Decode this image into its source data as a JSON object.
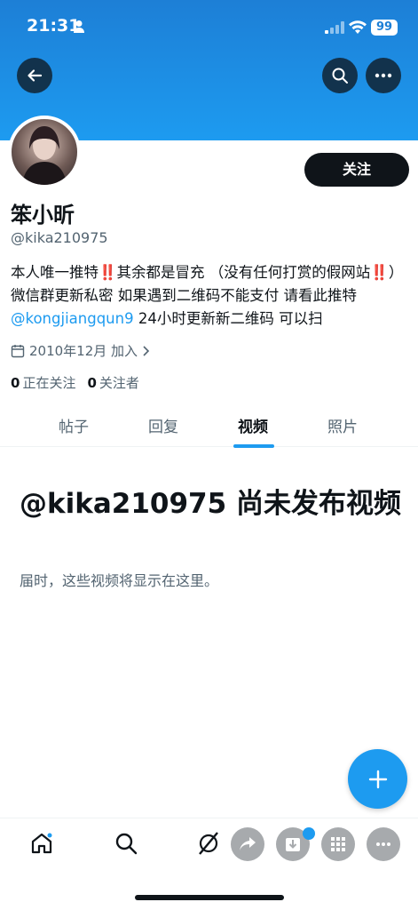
{
  "status_bar": {
    "time": "21:31",
    "battery": "99"
  },
  "profile": {
    "name": "笨小昕",
    "handle": "@kika210975",
    "follow_label": "关注",
    "bio": {
      "part1": "本人唯一推特",
      "bang": "‼️",
      "part2": "其余都是冒充 （没有任何打赏的假网站",
      "part3": "）微信群更新私密 如果遇到二维码不能支付 请看此推特",
      "link": "@kongjiangqun9",
      "part4": " 24小时更新新二维码 可以扫"
    },
    "joined": "2010年12月 加入",
    "following_count": "0",
    "following_label": "正在关注",
    "followers_count": "0",
    "followers_label": "关注者"
  },
  "tabs": [
    {
      "label": "帖子"
    },
    {
      "label": "回复"
    },
    {
      "label": "视频"
    },
    {
      "label": "照片"
    }
  ],
  "active_tab": "视频",
  "empty_state": {
    "title": "@kika210975 尚未发布视频",
    "subtitle": "届时，这些视频将显示在这里。"
  },
  "colors": {
    "accent": "#1d9bf0",
    "text": "#0f1419",
    "muted": "#536471"
  },
  "icons": [
    "back-arrow-icon",
    "search-icon",
    "more-icon",
    "calendar-icon",
    "chevron-right-icon",
    "plus-icon",
    "home-icon",
    "search-icon",
    "grok-icon",
    "share-icon",
    "download-icon",
    "grid-icon",
    "more-icon"
  ]
}
